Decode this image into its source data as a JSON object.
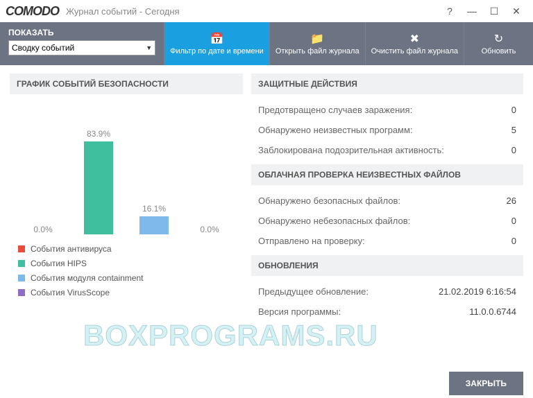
{
  "titlebar": {
    "logo": "COMODO",
    "title": "Журнал событий - Сегодня"
  },
  "toolbar": {
    "show_label": "ПОКАЗАТЬ",
    "show_value": "Сводку событий",
    "filter_label": "Фильтр по дате и времени",
    "open_label": "Открыть файл журнала",
    "clear_label": "Очистить файл журнала",
    "refresh_label": "Обновить"
  },
  "chart_section_title": "ГРАФИК СОБЫТИЙ БЕЗОПАСНОСТИ",
  "chart_data": {
    "type": "bar",
    "categories": [
      "События антивируса",
      "События HIPS",
      "События модуля containment",
      "События VirusScope"
    ],
    "series": [
      {
        "name": "percent",
        "values": [
          0.0,
          83.9,
          16.1,
          0.0
        ]
      }
    ],
    "labels": [
      "0.0%",
      "83.9%",
      "16.1%",
      "0.0%"
    ],
    "colors": [
      "#e74c3c",
      "#3fbf9d",
      "#7fb8ea",
      "#8e6bc5"
    ],
    "ylim": [
      0,
      100
    ],
    "xlabel": "",
    "ylabel": "",
    "title": ""
  },
  "legend": {
    "items": [
      {
        "color": "#e74c3c",
        "label": "События антивируса"
      },
      {
        "color": "#3fbf9d",
        "label": "События HIPS"
      },
      {
        "color": "#7fb8ea",
        "label": "События модуля containment"
      },
      {
        "color": "#8e6bc5",
        "label": "События VirusScope"
      }
    ]
  },
  "sections": {
    "defense": {
      "title": "ЗАЩИТНЫЕ ДЕЙСТВИЯ",
      "rows": [
        {
          "label": "Предотвращено случаев заражения:",
          "value": "0"
        },
        {
          "label": "Обнаружено неизвестных программ:",
          "value": "5"
        },
        {
          "label": "Заблокирована подозрительная активность:",
          "value": "0"
        }
      ]
    },
    "cloud": {
      "title": "ОБЛАЧНАЯ ПРОВЕРКА НЕИЗВЕСТНЫХ ФАЙЛОВ",
      "rows": [
        {
          "label": "Обнаружено безопасных файлов:",
          "value": "26"
        },
        {
          "label": "Обнаружено небезопасных файлов:",
          "value": "0"
        },
        {
          "label": "Отправлено на проверку:",
          "value": "0"
        }
      ]
    },
    "updates": {
      "title": "ОБНОВЛЕНИЯ",
      "rows": [
        {
          "label": "Предыдущее обновление:",
          "value": "21.02.2019 6:16:54"
        },
        {
          "label": "Версия программы:",
          "value": "11.0.0.6744"
        }
      ]
    }
  },
  "footer": {
    "close_label": "ЗАКРЫТЬ"
  },
  "watermark": "BOXPROGRAMS.RU"
}
